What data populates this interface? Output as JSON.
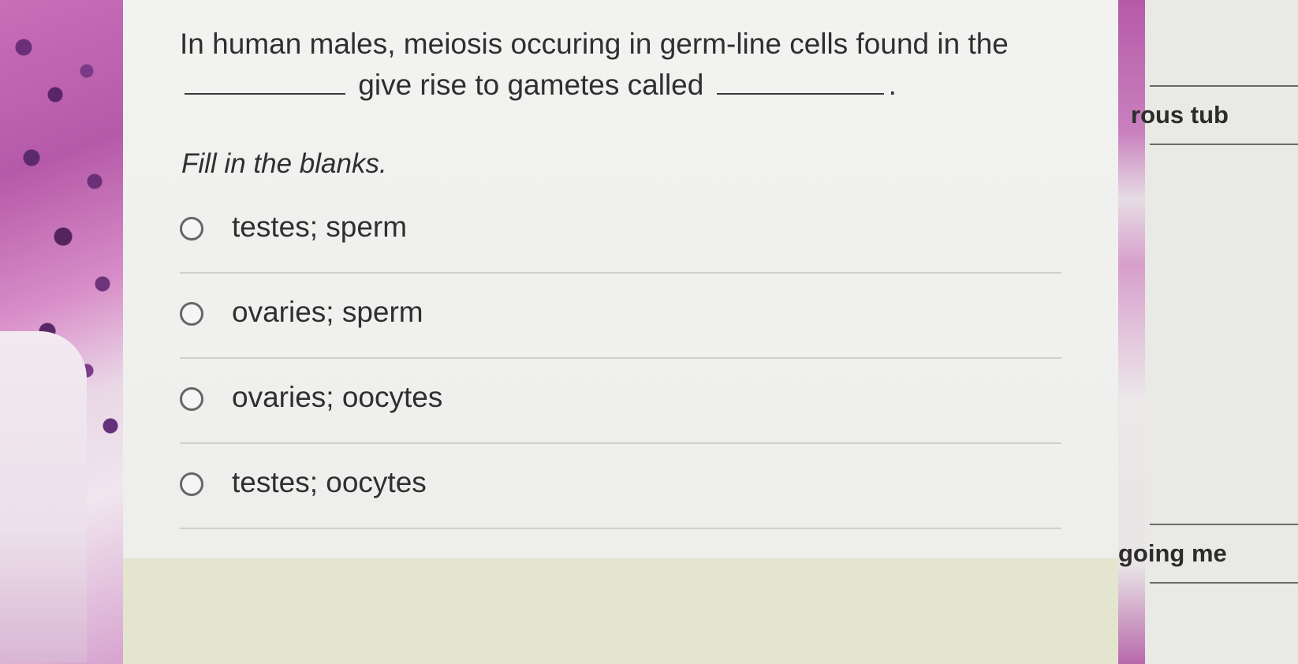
{
  "question": {
    "text_part1": "In human males, meiosis occuring in germ-line cells found in the",
    "text_part2": "give rise to gametes called",
    "text_end": ".",
    "instruction": "Fill in the blanks."
  },
  "options": [
    {
      "label": "testes; sperm",
      "selected": false
    },
    {
      "label": "ovaries; sperm",
      "selected": false
    },
    {
      "label": "ovaries; oocytes",
      "selected": false
    },
    {
      "label": "testes; oocytes",
      "selected": false
    }
  ],
  "right_panel": {
    "snippet_1": "rous tub",
    "snippet_2": "going me"
  }
}
